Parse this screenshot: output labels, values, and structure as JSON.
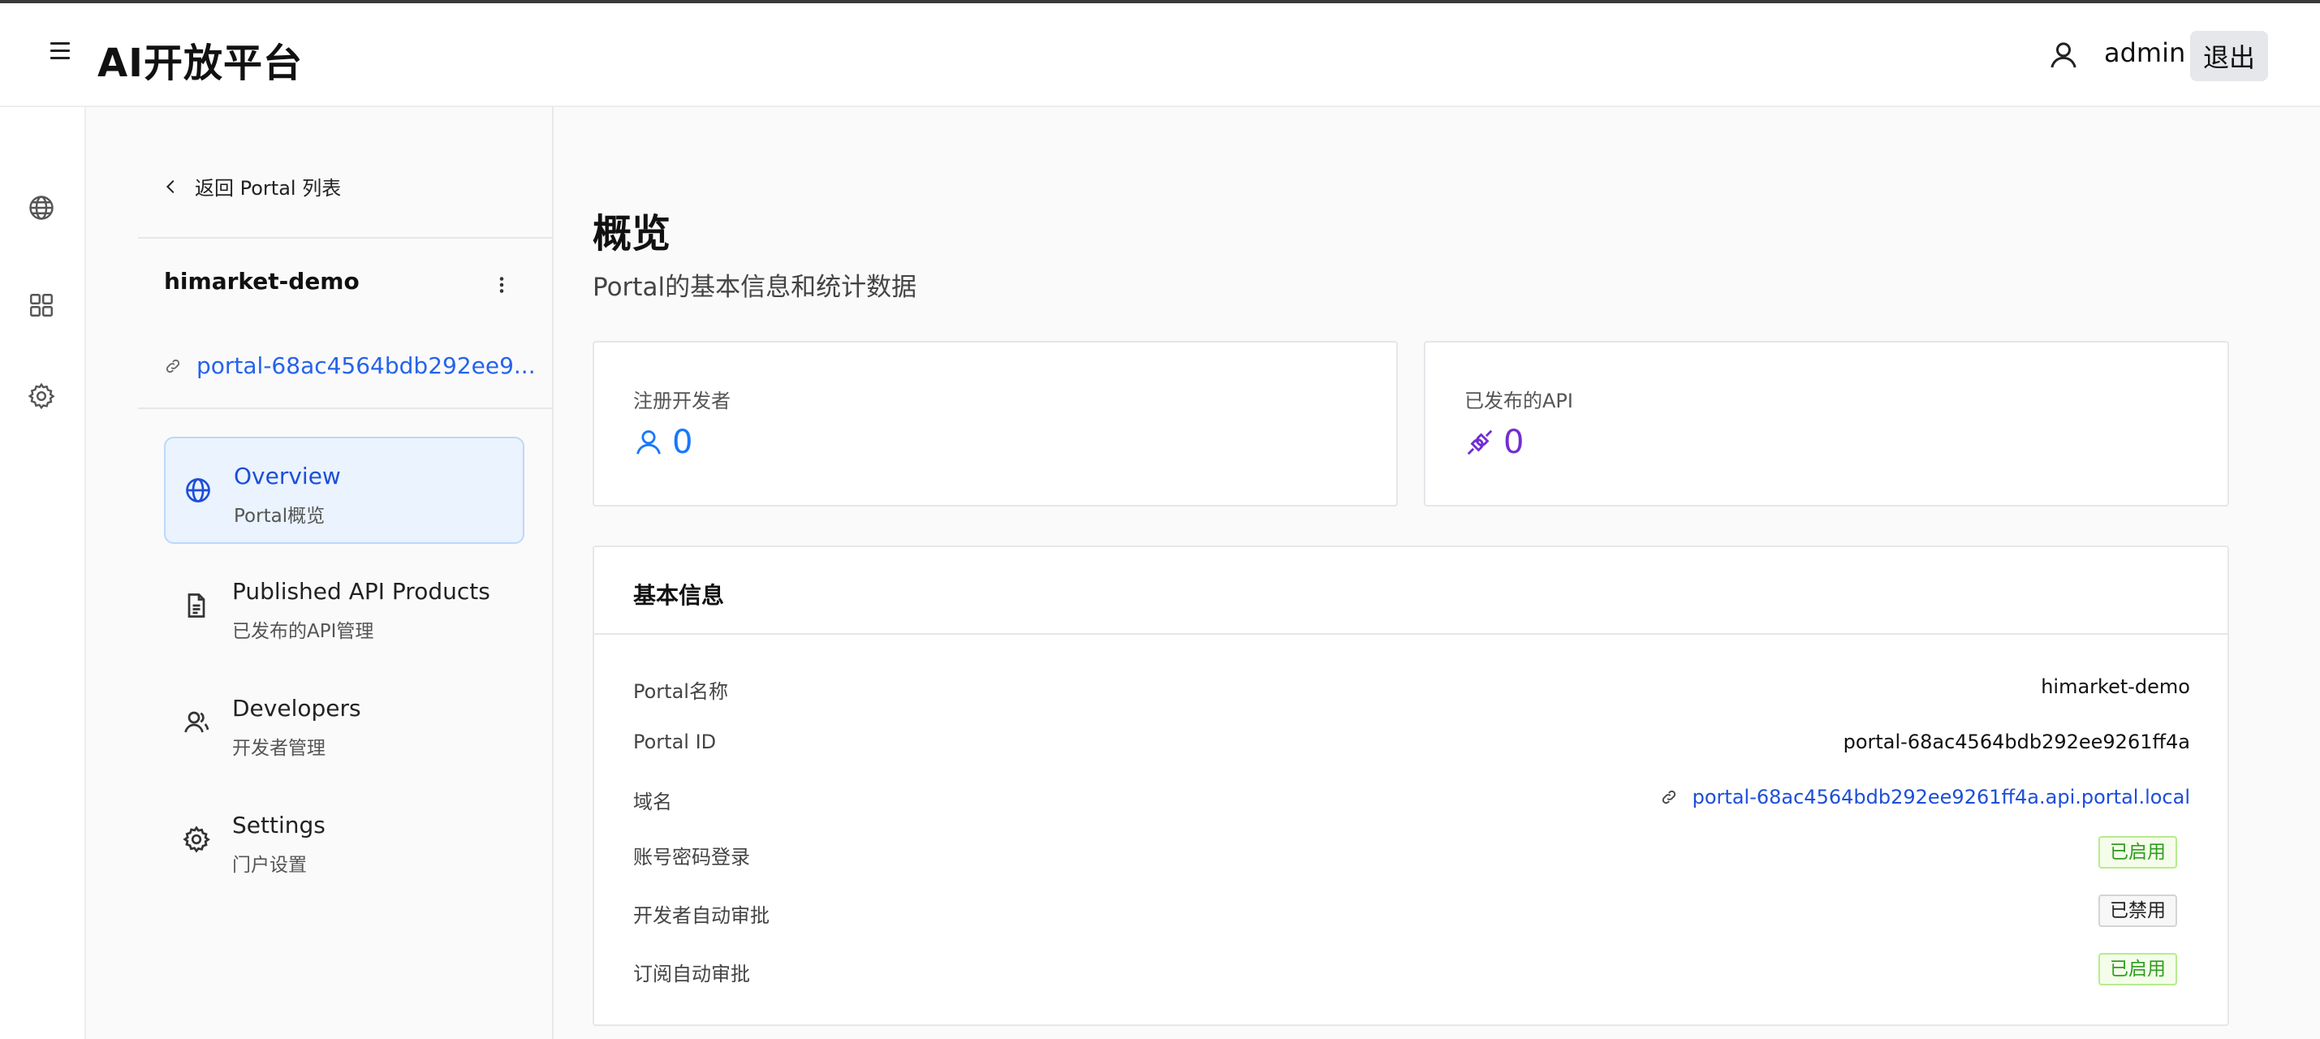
{
  "header": {
    "title": "AI开放平台",
    "username": "admin",
    "logout_label": "退出"
  },
  "rail": {
    "icons": [
      "globe-icon",
      "grid-icon",
      "gear-icon"
    ]
  },
  "sidebar": {
    "back_label": "返回 Portal 列表",
    "portal_name": "himarket-demo",
    "portal_link": "portal-68ac4564bdb292ee9...",
    "items": [
      {
        "title": "Overview",
        "subtitle": "Portal概览",
        "icon": "globe-icon",
        "active": true
      },
      {
        "title": "Published API Products",
        "subtitle": "已发布的API管理",
        "icon": "document-icon"
      },
      {
        "title": "Developers",
        "subtitle": "开发者管理",
        "icon": "users-icon"
      },
      {
        "title": "Settings",
        "subtitle": "门户设置",
        "icon": "gear-icon"
      }
    ]
  },
  "main": {
    "title": "概览",
    "subtitle": "Portal的基本信息和统计数据",
    "stats": [
      {
        "label": "注册开发者",
        "value": "0",
        "icon": "user-icon",
        "color": "#1677ff"
      },
      {
        "label": "已发布的API",
        "value": "0",
        "icon": "api-plug-icon",
        "color": "#722ed1"
      }
    ],
    "info": {
      "title": "基本信息",
      "rows": [
        {
          "label": "Portal名称",
          "value": "himarket-demo"
        },
        {
          "label": "Portal ID",
          "value": "portal-68ac4564bdb292ee9261ff4a"
        },
        {
          "label": "域名",
          "value": "portal-68ac4564bdb292ee9261ff4a.api.portal.local"
        },
        {
          "label": "账号密码登录",
          "value": "已启用"
        },
        {
          "label": "开发者自动审批",
          "value": "已禁用"
        },
        {
          "label": "订阅自动审批",
          "value": "已启用"
        }
      ]
    }
  }
}
